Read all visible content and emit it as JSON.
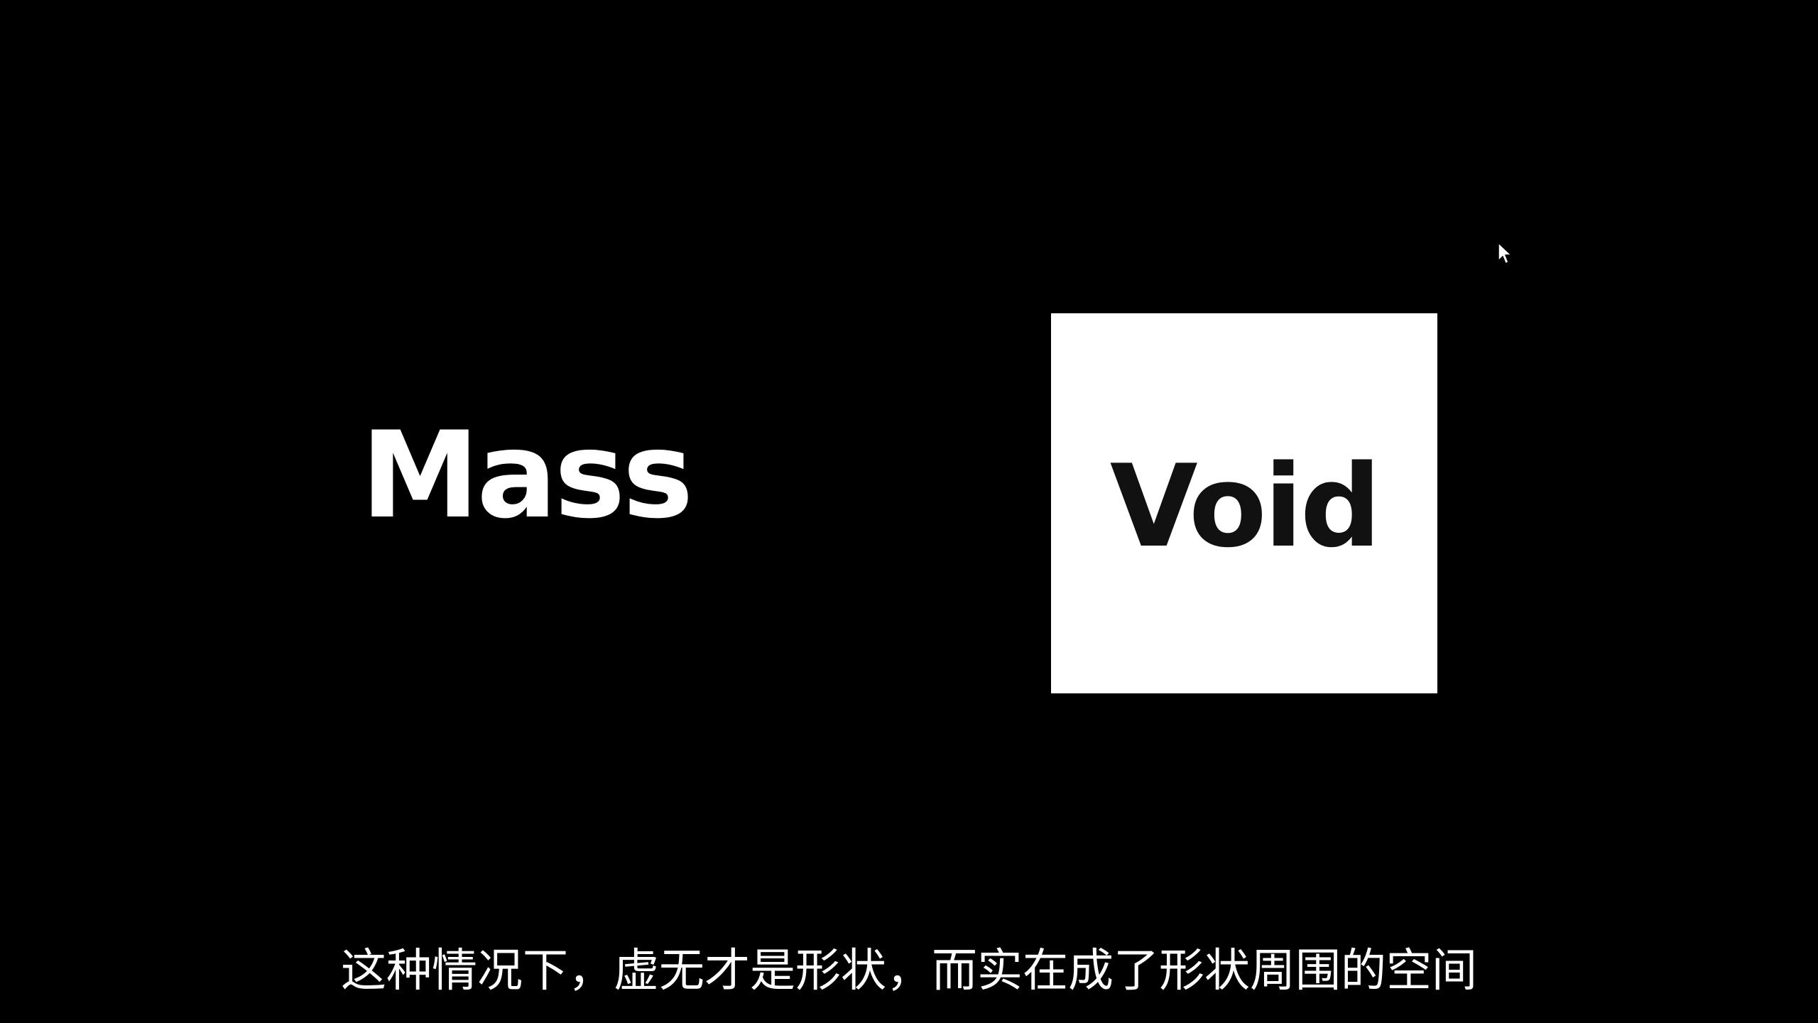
{
  "slide": {
    "left_word": "Mass",
    "right_word": "Void"
  },
  "subtitle": {
    "text": "这种情况下，虚无才是形状，而实在成了形状周围的空间"
  },
  "cursor": {
    "icon": "mouse-pointer-icon"
  },
  "colors": {
    "background": "#000000",
    "text_light": "#ffffff",
    "box_fill": "#ffffff",
    "text_dark": "#111111"
  }
}
